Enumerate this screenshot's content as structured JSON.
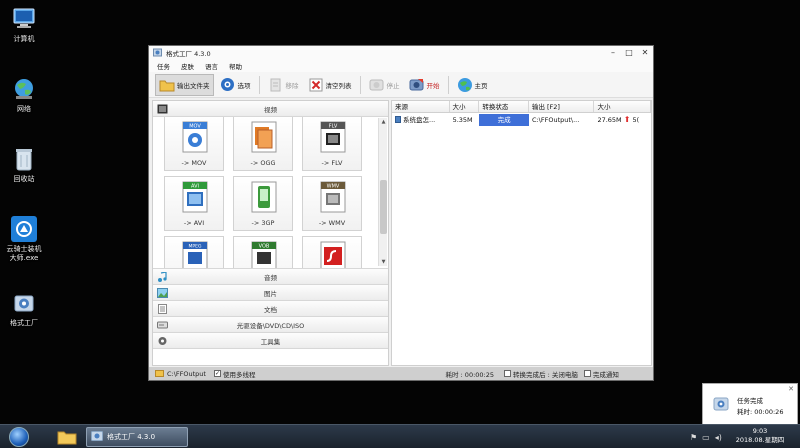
{
  "desktop": {
    "icons": [
      {
        "label": "计算机"
      },
      {
        "label": "网络"
      },
      {
        "label": "回收站"
      },
      {
        "label": "云骑士装机大师.exe"
      },
      {
        "label": "格式工厂"
      }
    ]
  },
  "window": {
    "title": "格式工厂 4.3.0",
    "menu": [
      "任务",
      "皮肤",
      "语言",
      "帮助"
    ],
    "toolbar": {
      "output_folder": "输出文件夹",
      "options": "选项",
      "remove": "移除",
      "clear_list": "清空列表",
      "stop": "停止",
      "start": "开始",
      "home": "主页"
    },
    "categories": {
      "video": "视频",
      "audio": "音频",
      "image": "图片",
      "document": "文档",
      "disc": "光驱设备\\DVD\\CD\\ISO",
      "toolbox": "工具集"
    },
    "formats": [
      {
        "label": "-> MOV",
        "badge": "MOV",
        "color": "#3a7ed6"
      },
      {
        "label": "-> OGG",
        "badge": "",
        "color": "#e07a25"
      },
      {
        "label": "-> FLV",
        "badge": "FLV",
        "color": "#555555"
      },
      {
        "label": "-> AVI",
        "badge": "AVI",
        "color": "#2f9a3a"
      },
      {
        "label": "-> 3GP",
        "badge": "",
        "color": "#3c9a3c"
      },
      {
        "label": "-> WMV",
        "badge": "WMV",
        "color": "#6b5a3a"
      },
      {
        "label": "",
        "badge": "MPEG",
        "color": "#2a62b8"
      },
      {
        "label": "",
        "badge": "VOB",
        "color": "#2f7a2f"
      },
      {
        "label": "",
        "badge": "",
        "color": "#d32020"
      }
    ],
    "table": {
      "columns": [
        "来源",
        "大小",
        "转换状态",
        "输出 [F2]",
        "大小"
      ],
      "rows": [
        {
          "source": "系统盘怎...",
          "size": "5.35M",
          "status": "完成",
          "output": "C:\\FFOutput\\...",
          "out_size": "27.65M",
          "extra": "5("
        }
      ]
    },
    "status_bar": {
      "output_path": "C:\\FFOutput",
      "multithread": "使用多线程",
      "elapsed": "耗时 : 00:00:25",
      "after_convert": "转换完成后 : 关闭电脑",
      "notify": "完成通知"
    }
  },
  "notification": {
    "title": "任务完成",
    "elapsed": "耗时: 00:00:26"
  },
  "taskbar": {
    "task_label": "格式工厂 4.3.0",
    "time": "9:03",
    "date": "2018.08.星期四"
  }
}
